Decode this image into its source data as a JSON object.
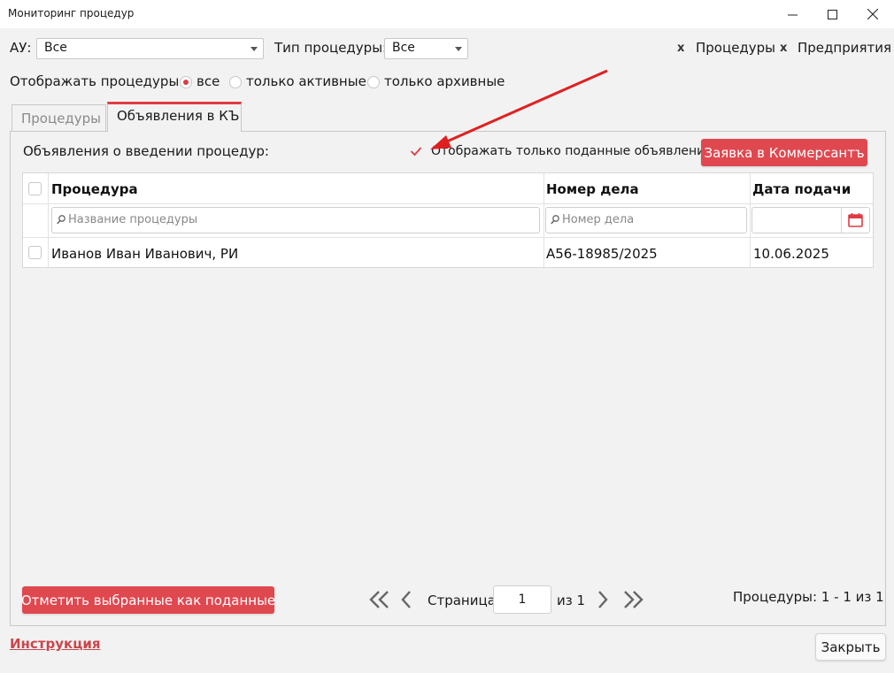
{
  "window": {
    "title": "Мониторинг процедур"
  },
  "filters": {
    "au_label": "АУ:",
    "au_value": "Все",
    "type_label": "Тип процедуры:",
    "type_value": "Все",
    "tag_procedures": "Процедуры",
    "tag_enterprises": "Предприятия",
    "tag_close_glyph": "x"
  },
  "display": {
    "label": "Отображать процедуры:",
    "options": [
      {
        "label": "все",
        "selected": true
      },
      {
        "label": "только активные",
        "selected": false
      },
      {
        "label": "только архивные",
        "selected": false
      }
    ]
  },
  "tabs": [
    {
      "label": "Процедуры",
      "active": false
    },
    {
      "label": "Объявления в КЪ",
      "active": true
    }
  ],
  "announcements": {
    "section_label": "Объявления о введении процедур:",
    "only_submitted_label": "Отображать только поданные объявления",
    "only_submitted_checked": true,
    "kommersant_button": "Заявка в Коммерсантъ"
  },
  "table": {
    "columns": [
      "Процедура",
      "Номер дела",
      "Дата подачи"
    ],
    "filter_placeholders": {
      "procedure": "Название процедуры",
      "case_number": "Номер дела"
    },
    "rows": [
      {
        "procedure": "Иванов Иван Иванович, РИ",
        "case_number": "А56-18985/2025",
        "date": "10.06.2025",
        "checked": false
      }
    ]
  },
  "footer": {
    "mark_button": "Отметить выбранные как поданные",
    "page_label": "Страница",
    "page_value": "1",
    "page_of": "из 1",
    "count_text": "Процедуры: 1 - 1 из 1",
    "instruction_link": "Инструкция",
    "close_button": "Закрыть"
  },
  "colors": {
    "accent": "#e04850",
    "annotation_arrow": "#e02020"
  }
}
